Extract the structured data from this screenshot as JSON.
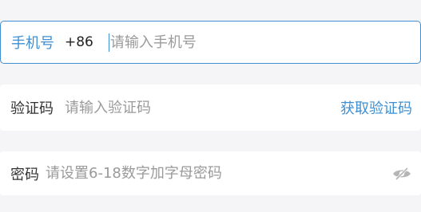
{
  "phone": {
    "label": "手机号",
    "country_code": "+86",
    "placeholder": "请输入手机号"
  },
  "code": {
    "label": "验证码",
    "placeholder": "请输入验证码",
    "get_code_label": "获取验证码"
  },
  "password": {
    "label": "密码",
    "placeholder": "请设置6-18数字加字母密码",
    "toggle_icon": "eye-slash-icon"
  },
  "colors": {
    "accent": "#3f8fd2",
    "background": "#f5f5f7",
    "placeholder": "#9a9a9a",
    "icon": "#b5b5b5"
  }
}
